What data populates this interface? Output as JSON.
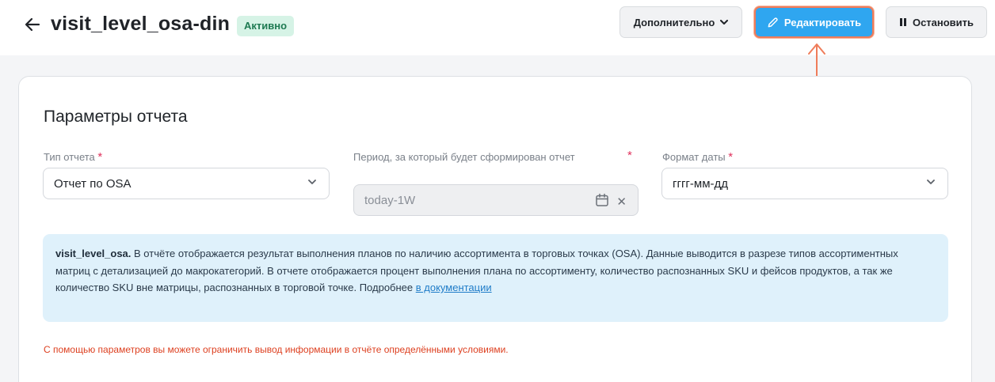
{
  "header": {
    "title": "visit_level_osa-din",
    "status_badge": "Активно",
    "more_label": "Дополнительно",
    "edit_label": "Редактировать",
    "stop_label": "Остановить"
  },
  "card": {
    "title": "Параметры отчета",
    "fields": {
      "report_type": {
        "label": "Тип отчета",
        "value": "Отчет по OSA"
      },
      "period": {
        "label": "Период, за который будет сформирован отчет",
        "value": "today-1W"
      },
      "date_format": {
        "label": "Формат даты",
        "value": "гггг-мм-дд"
      }
    },
    "required_mark": "*",
    "info": {
      "bold": "visit_level_osa.",
      "text": " В отчёте отображается результат выполнения планов по наличию ассортимента в торговых точках (OSA). Данные выводится в разрезе типов ассортиментных матриц с детализацией до макрокатегорий. В отчете отображается процент выполнения плана по ассортименту, количество распознанных SKU и фейсов продуктов, а так же количество SKU вне матрицы, распознанных в торговой точке. Подробнее ",
      "link": "в документации"
    },
    "note": "С помощью параметров вы можете ограничить вывод информации в отчёте определёнными условиями."
  },
  "colors": {
    "accent": "#2fa6f0",
    "highlight": "#ef7c5a",
    "badge_bg": "#d6f3e6",
    "badge_text": "#1e7a52",
    "required": "#e0315c",
    "info_bg": "#dff1fb",
    "note": "#dd3f1f"
  },
  "icons": [
    "back-arrow-icon",
    "chevron-down-icon",
    "pencil-icon",
    "pause-icon",
    "calendar-icon",
    "clear-icon",
    "annotation-arrow-icon"
  ]
}
